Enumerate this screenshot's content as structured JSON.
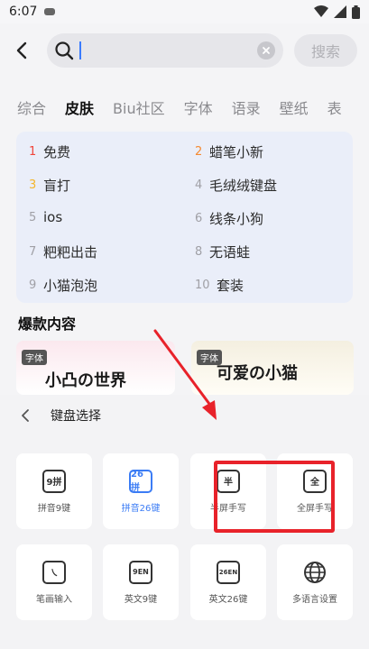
{
  "status": {
    "time": "6:07"
  },
  "search": {
    "value": "",
    "button_label": "搜索"
  },
  "tabs": [
    "综合",
    "皮肤",
    "Biu社区",
    "字体",
    "语录",
    "壁纸",
    "表"
  ],
  "active_tab": "皮肤",
  "hot_list": [
    {
      "rank": "1",
      "text": "免费"
    },
    {
      "rank": "2",
      "text": "蜡笔小新"
    },
    {
      "rank": "3",
      "text": "盲打"
    },
    {
      "rank": "4",
      "text": "毛绒绒键盘"
    },
    {
      "rank": "5",
      "text": "ios"
    },
    {
      "rank": "6",
      "text": "线条小狗"
    },
    {
      "rank": "7",
      "text": "粑粑出击"
    },
    {
      "rank": "8",
      "text": "无语蛙"
    },
    {
      "rank": "9",
      "text": "小猫泡泡"
    },
    {
      "rank": "10",
      "text": "套装"
    }
  ],
  "section": {
    "title": "爆款内容"
  },
  "thumbnails": [
    {
      "badge": "字体",
      "art": "小凸の世界"
    },
    {
      "badge": "字体",
      "art": "可爱の小猫"
    }
  ],
  "panel": {
    "title": "键盘选择",
    "keys": [
      {
        "label": "拼音9键",
        "icon_text": "9拼",
        "icon": "pinyin-9-icon"
      },
      {
        "label": "拼音26键",
        "icon_text": "26拼",
        "icon": "pinyin-26-icon",
        "active": true
      },
      {
        "label": "半屏手写",
        "icon_text": "半",
        "icon": "half-handwrite-icon"
      },
      {
        "label": "全屏手写",
        "icon_text": "全",
        "icon": "full-handwrite-icon"
      },
      {
        "label": "笔画输入",
        "icon_text": "㇏",
        "icon": "stroke-input-icon"
      },
      {
        "label": "英文9键",
        "icon_text": "9EN",
        "icon": "english-9-icon"
      },
      {
        "label": "英文26键",
        "icon_text": "26EN",
        "icon": "english-26-icon"
      },
      {
        "label": "多语言设置",
        "icon_text": "",
        "icon": "globe-icon"
      }
    ]
  },
  "colors": {
    "accent": "#3b7cf5",
    "highlight": "#e8222a",
    "rank1": "#f0453a",
    "rank2": "#f58a32",
    "rank3": "#f4b62c"
  }
}
